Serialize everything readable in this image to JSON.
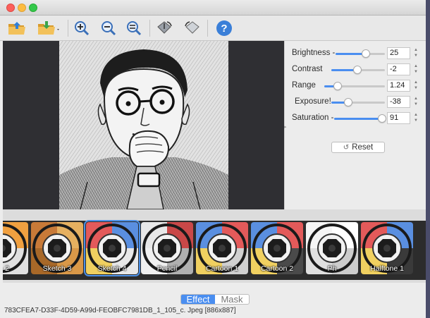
{
  "toolbar": {
    "buttons": [
      {
        "name": "open-image-button",
        "icon": "folder-open-icon"
      },
      {
        "name": "save-image-button",
        "icon": "folder-save-icon"
      },
      {
        "name": "zoom-in-button",
        "icon": "zoom-in-icon"
      },
      {
        "name": "zoom-out-button",
        "icon": "zoom-out-icon"
      },
      {
        "name": "zoom-fit-button",
        "icon": "zoom-fit-icon"
      },
      {
        "name": "rotate-left-button",
        "icon": "rotate-left-icon"
      },
      {
        "name": "rotate-right-button",
        "icon": "rotate-right-icon"
      },
      {
        "name": "help-button",
        "icon": "question-icon"
      }
    ]
  },
  "adjustments": {
    "brightness": {
      "label": "Brightness -",
      "value": "25",
      "fraction": 0.62
    },
    "contrast": {
      "label": "Contrast",
      "value": "-2",
      "fraction": 0.49
    },
    "range": {
      "label": "Range",
      "value": "1.24",
      "fraction": 0.22
    },
    "exposure": {
      "label": "Exposure!",
      "value": "-38",
      "fraction": 0.31
    },
    "saturation": {
      "label": "Saturation -",
      "value": "91",
      "fraction": 0.95
    },
    "reset_label": "Reset"
  },
  "effects": [
    {
      "label": "ch 2",
      "palette": [
        "#c63b3b",
        "#f0a040",
        "#5a8fd0",
        "#e0e0e0"
      ]
    },
    {
      "label": "Sketch 3",
      "palette": [
        "#c87a38",
        "#e6b060",
        "#a86828",
        "#d99848"
      ]
    },
    {
      "label": "Sketch 4",
      "palette": [
        "#e35a5a",
        "#5a8fe0",
        "#f0d060",
        "#e8e8e8"
      ],
      "selected": true
    },
    {
      "label": "Pencil",
      "palette": [
        "#e8e8e8",
        "#c94848",
        "#f0f0f0",
        "#b0b0b0"
      ]
    },
    {
      "label": "Cartoon 1",
      "palette": [
        "#5a8fe0",
        "#e35a5a",
        "#f0d060",
        "#d0d0d0"
      ]
    },
    {
      "label": "Cartoon 2",
      "palette": [
        "#5a8fe0",
        "#e35a5a",
        "#f0d060",
        "#4a4a4a"
      ]
    },
    {
      "label": "Ph",
      "palette": [
        "#f5f5f5",
        "#ffffff",
        "#e0e0e0",
        "#cccccc"
      ]
    },
    {
      "label": "Halftone 1",
      "palette": [
        "#e35a5a",
        "#5a8fe0",
        "#f0d060",
        "#3a3a3a"
      ]
    }
  ],
  "mode_tabs": {
    "effect": "Effect",
    "mask": "Mask"
  },
  "status": "783CFEA7-D33F-4D59-A99d-FEOBFC7981DB_1_105_c. Jpeg [886x887]"
}
